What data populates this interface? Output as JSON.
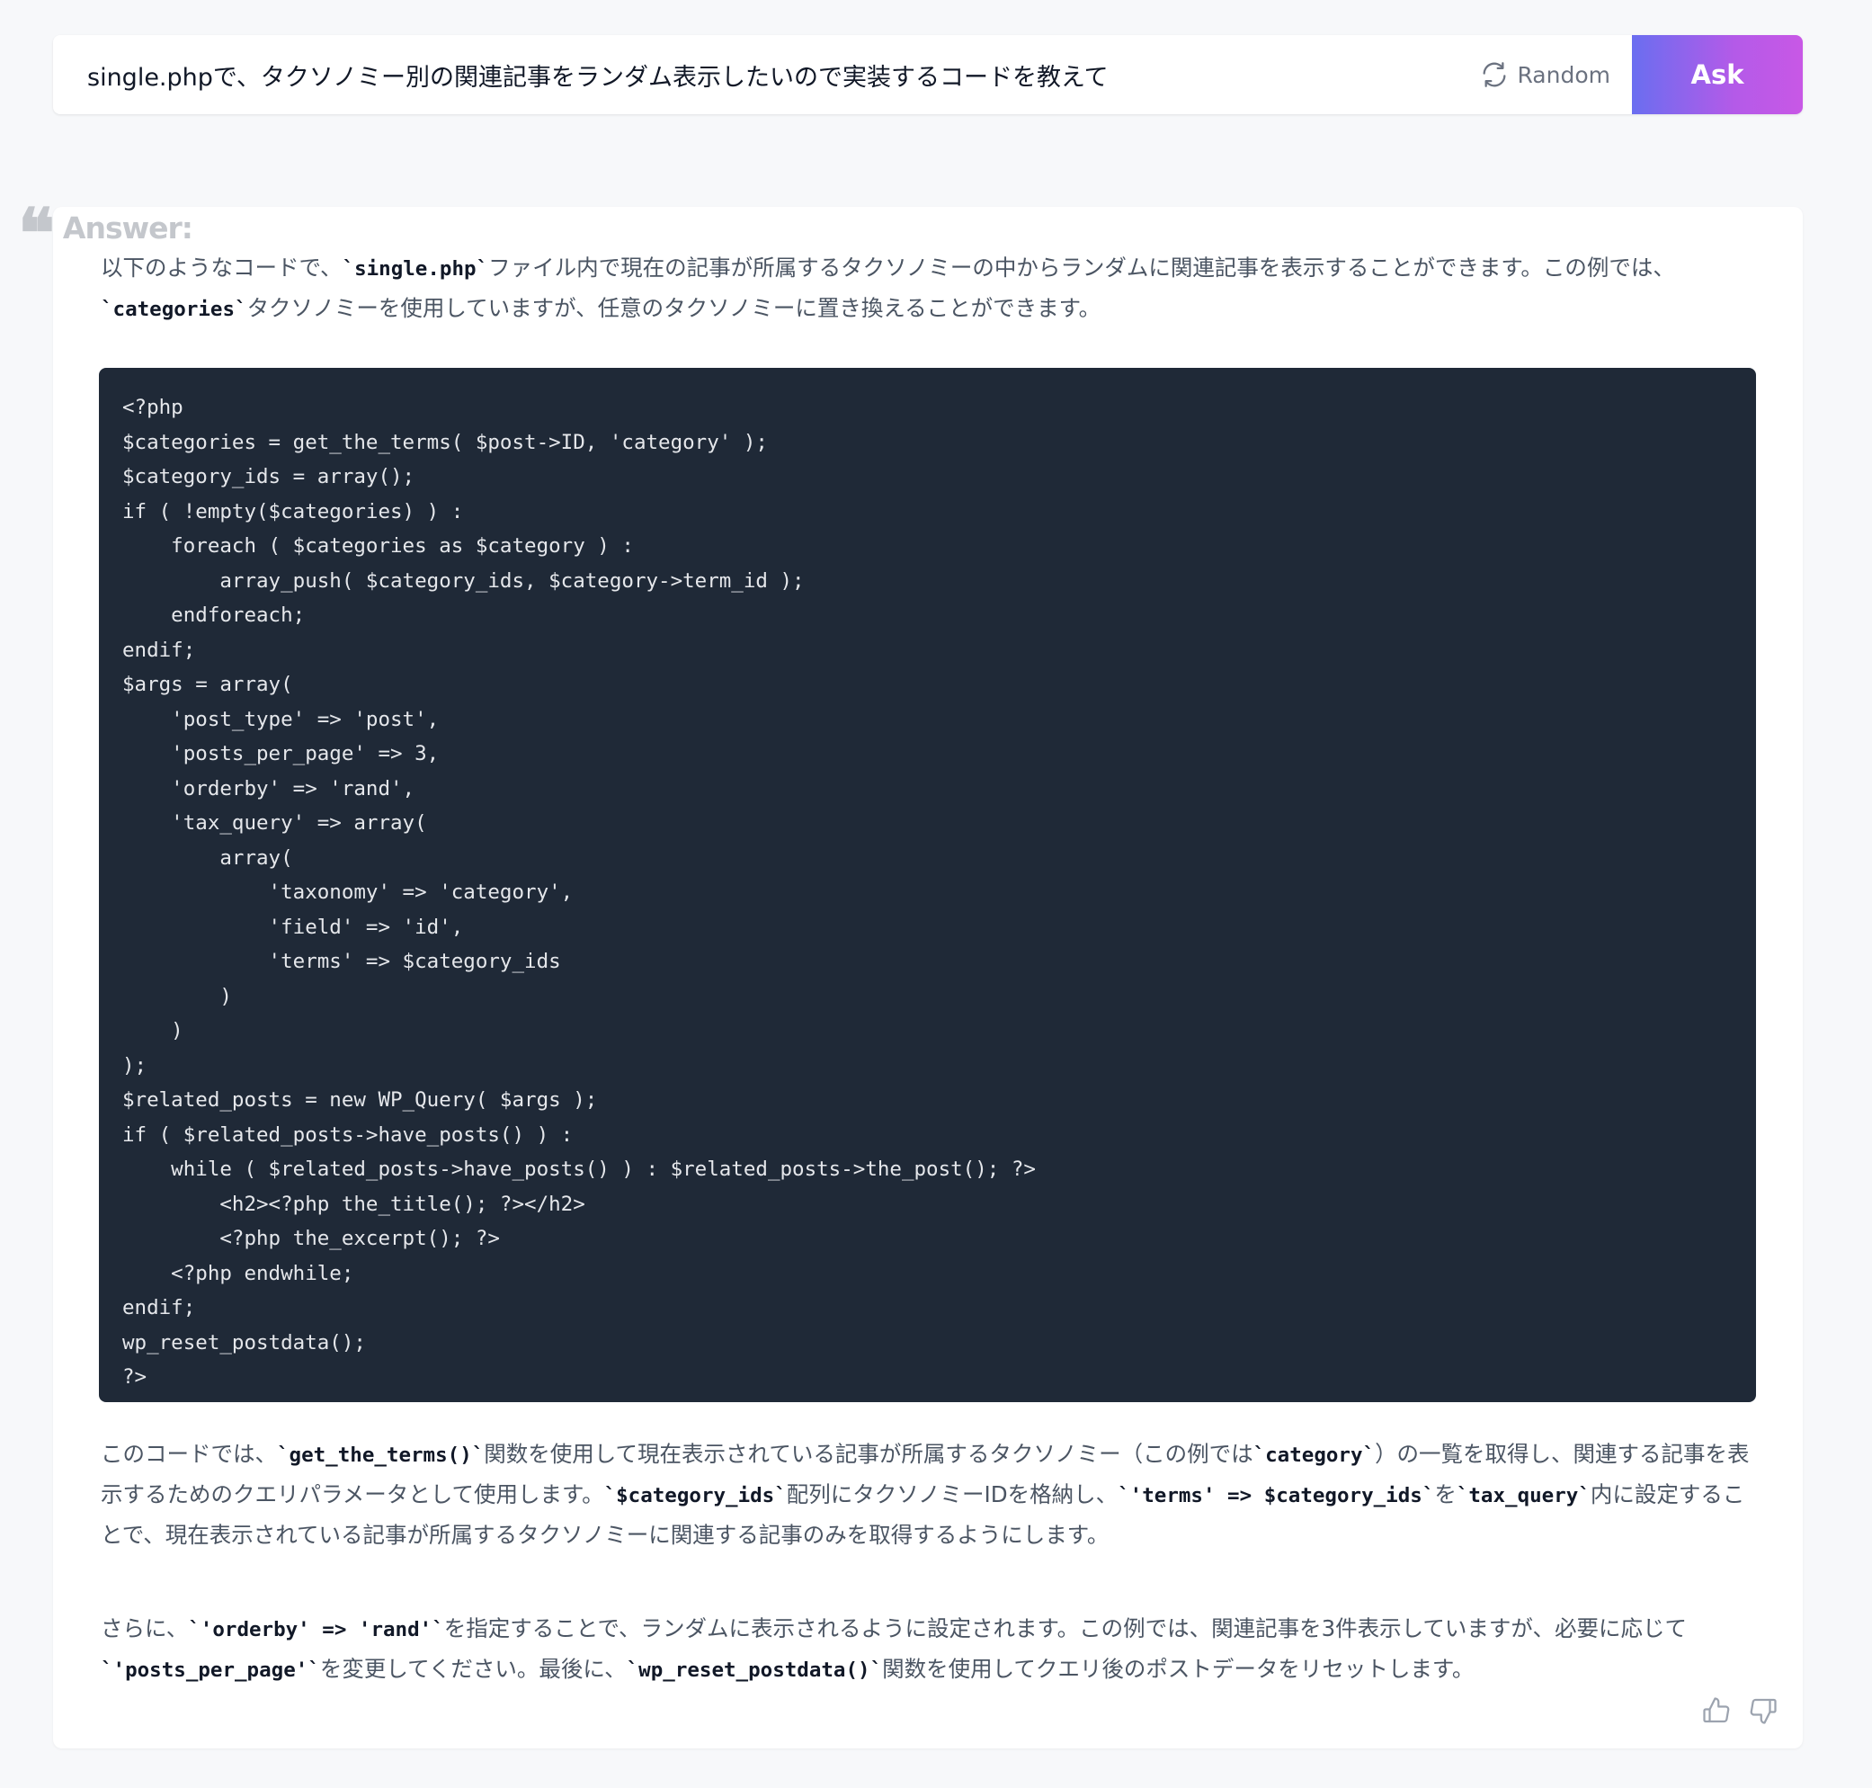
{
  "query": {
    "text": "single.phpで、タクソノミー別の関連記事をランダム表示したいので実装するコードを教えて",
    "random_label": "Random",
    "ask_label": "Ask"
  },
  "answer": {
    "label": "Answer:",
    "intro": {
      "t1": "以下のようなコードで、",
      "c1": "`single.php`",
      "t2": "ファイル内で現在の記事が所属するタクソノミーの中からランダムに関連記事を表示することができます。この例では、",
      "c2": "`categories`",
      "t3": "タクソノミーを使用していますが、任意のタクソノミーに置き換えることができます。"
    },
    "code": "<?php\n$categories = get_the_terms( $post->ID, 'category' );\n$category_ids = array();\nif ( !empty($categories) ) :\n    foreach ( $categories as $category ) :\n        array_push( $category_ids, $category->term_id );\n    endforeach;\nendif;\n$args = array(\n    'post_type' => 'post',\n    'posts_per_page' => 3,\n    'orderby' => 'rand',\n    'tax_query' => array(\n        array(\n            'taxonomy' => 'category',\n            'field' => 'id',\n            'terms' => $category_ids\n        )\n    )\n);\n$related_posts = new WP_Query( $args );\nif ( $related_posts->have_posts() ) :\n    while ( $related_posts->have_posts() ) : $related_posts->the_post(); ?>\n        <h2><?php the_title(); ?></h2>\n        <?php the_excerpt(); ?>\n    <?php endwhile;\nendif;\nwp_reset_postdata();\n?>",
    "explain1": {
      "t1": "このコードでは、",
      "c1": "`get_the_terms()`",
      "t2": "関数を使用して現在表示されている記事が所属するタクソノミー（この例では",
      "c2": "`category`",
      "t3": "）の一覧を取得し、関連する記事を表示するためのクエリパラメータとして使用します。",
      "c3": "`$category_ids`",
      "t4": "配列にタクソノミーIDを格納し、",
      "c4": "`'terms' => $category_ids`",
      "t5": "を",
      "c5": "`tax_query`",
      "t6": "内に設定することで、現在表示されている記事が所属するタクソノミーに関連する記事のみを取得するようにします。"
    },
    "explain2": {
      "t1": "さらに、",
      "c1": "`'orderby' => 'rand'`",
      "t2": "を指定することで、ランダムに表示されるように設定されます。この例では、関連記事を3件表示していますが、必要に応じて",
      "c2": "`'posts_per_page'`",
      "t3": "を変更してください。最後に、",
      "c3": "`wp_reset_postdata()`",
      "t4": "関数を使用してクエリ後のポストデータをリセットします。"
    }
  },
  "icons": {
    "random": "refresh-icon",
    "thumbs_up": "thumbs-up-icon",
    "thumbs_down": "thumbs-down-icon",
    "quote": "quote-icon"
  },
  "colors": {
    "ask_gradient_start": "#6a6ef0",
    "ask_gradient_end": "#c858e6",
    "code_background": "#1f2937"
  }
}
